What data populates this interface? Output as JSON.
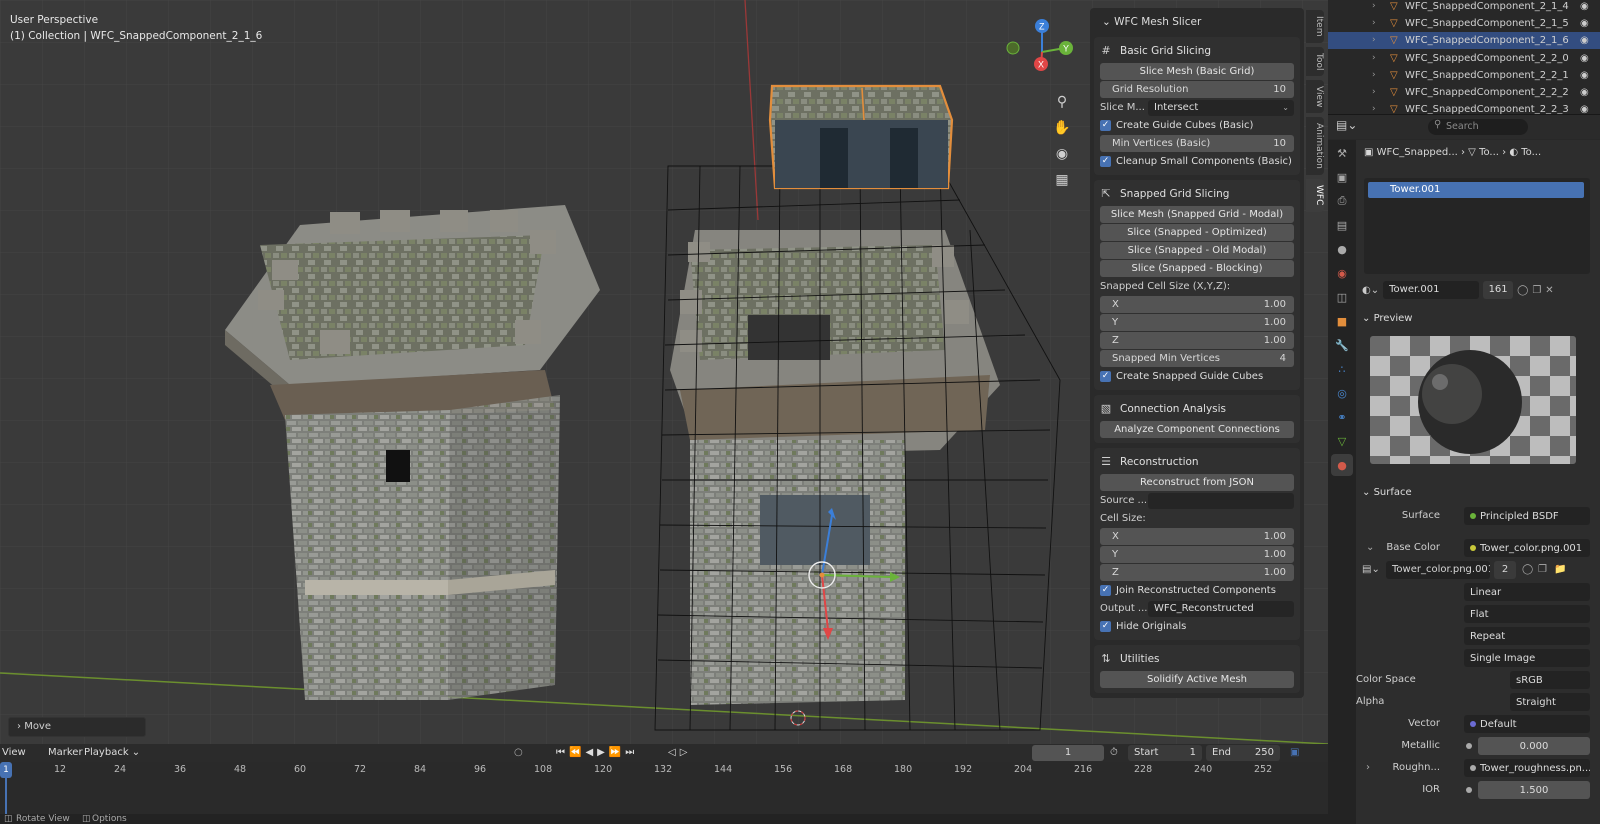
{
  "viewport": {
    "perspective": "User Perspective",
    "collection": "(1) Collection | WFC_SnappedComponent_2_1_6",
    "operator_panel": "Move",
    "axes": {
      "x": "X",
      "y": "Y",
      "z": "Z"
    }
  },
  "n_tabs": [
    "Item",
    "Tool",
    "View",
    "Animation",
    "WFC"
  ],
  "wfc": {
    "title": "WFC Mesh Slicer",
    "basic": {
      "header": "Basic Grid Slicing",
      "slice_btn": "Slice Mesh (Basic Grid)",
      "grid_res_label": "Grid Resolution",
      "grid_res_value": "10",
      "slice_mode_label": "Slice M...",
      "slice_mode_value": "Intersect",
      "create_guide": "Create Guide Cubes (Basic)",
      "min_vert_label": "Min Vertices (Basic)",
      "min_vert_value": "10",
      "cleanup": "Cleanup Small Components (Basic)"
    },
    "snapped": {
      "header": "Snapped Grid Slicing",
      "btn1": "Slice Mesh (Snapped Grid - Modal)",
      "btn2": "Slice (Snapped - Optimized)",
      "btn3": "Slice (Snapped - Old Modal)",
      "btn4": "Slice (Snapped - Blocking)",
      "cell_label": "Snapped Cell Size (X,Y,Z):",
      "x_label": "X",
      "x_value": "1.00",
      "y_label": "Y",
      "y_value": "1.00",
      "z_label": "Z",
      "z_value": "1.00",
      "min_vert_label": "Snapped Min Vertices",
      "min_vert_value": "4",
      "create_guide": "Create Snapped Guide Cubes"
    },
    "connection": {
      "header": "Connection Analysis",
      "btn": "Analyze Component Connections"
    },
    "recon": {
      "header": "Reconstruction",
      "btn": "Reconstruct from JSON",
      "source_label": "Source ...",
      "source_value": "",
      "cell_label": "Cell Size:",
      "x_label": "X",
      "x_value": "1.00",
      "y_label": "Y",
      "y_value": "1.00",
      "z_label": "Z",
      "z_value": "1.00",
      "join": "Join Reconstructed Components",
      "output_label": "Output ...",
      "output_value": "WFC_Reconstructed",
      "hide": "Hide Originals"
    },
    "utilities": {
      "header": "Utilities",
      "btn": "Solidify Active Mesh"
    }
  },
  "outliner": {
    "items": [
      {
        "name": "WFC_SnappedComponent_2_1_4",
        "selected": false
      },
      {
        "name": "WFC_SnappedComponent_2_1_5",
        "selected": false
      },
      {
        "name": "WFC_SnappedComponent_2_1_6",
        "selected": true
      },
      {
        "name": "WFC_SnappedComponent_2_2_0",
        "selected": false
      },
      {
        "name": "WFC_SnappedComponent_2_2_1",
        "selected": false
      },
      {
        "name": "WFC_SnappedComponent_2_2_2",
        "selected": false
      },
      {
        "name": "WFC_SnappedComponent_2_2_3",
        "selected": false
      }
    ]
  },
  "properties": {
    "search_placeholder": "Search",
    "crumb_object": "WFC_Snapped...",
    "crumb_mesh": "To...",
    "crumb_material": "To...",
    "slot_name": "Tower.001",
    "material_name": "Tower.001",
    "material_users": "161",
    "preview_label": "Preview",
    "surface_label": "Surface",
    "surface_key": "Surface",
    "surface_value": "Principled BSDF",
    "base_color_key": "Base Color",
    "base_color_value": "Tower_color.png.001",
    "image_name": "Tower_color.png.001",
    "image_users": "2",
    "interp": "Linear",
    "projection": "Flat",
    "extension": "Repeat",
    "source": "Single Image",
    "colorspace_key": "Color Space",
    "colorspace_value": "sRGB",
    "alpha_key": "Alpha",
    "alpha_value": "Straight",
    "vector_key": "Vector",
    "vector_value": "Default",
    "metallic_key": "Metallic",
    "metallic_value": "0.000",
    "roughness_key": "Roughn...",
    "roughness_value": "Tower_roughness.pn...",
    "ior_key": "IOR",
    "ior_value": "1.500"
  },
  "timeline": {
    "view": "View",
    "marker": "Marker",
    "playback": "Playback",
    "current_frame": "1",
    "start_label": "Start",
    "start_value": "1",
    "end_label": "End",
    "end_value": "250",
    "ticks": [
      "12",
      "24",
      "36",
      "48",
      "60",
      "72",
      "84",
      "96",
      "108",
      "120",
      "132",
      "144",
      "156",
      "168",
      "180",
      "192",
      "204",
      "216",
      "228",
      "240",
      "252"
    ],
    "playhead": "1"
  },
  "status": {
    "rotate": "Rotate View",
    "options": "Options"
  },
  "colors": {
    "accent": "#4772b3",
    "selection_orange": "#e38e3c",
    "x_axis": "#e04646",
    "y_axis": "#6ab33a",
    "z_axis": "#3b7fd9"
  }
}
